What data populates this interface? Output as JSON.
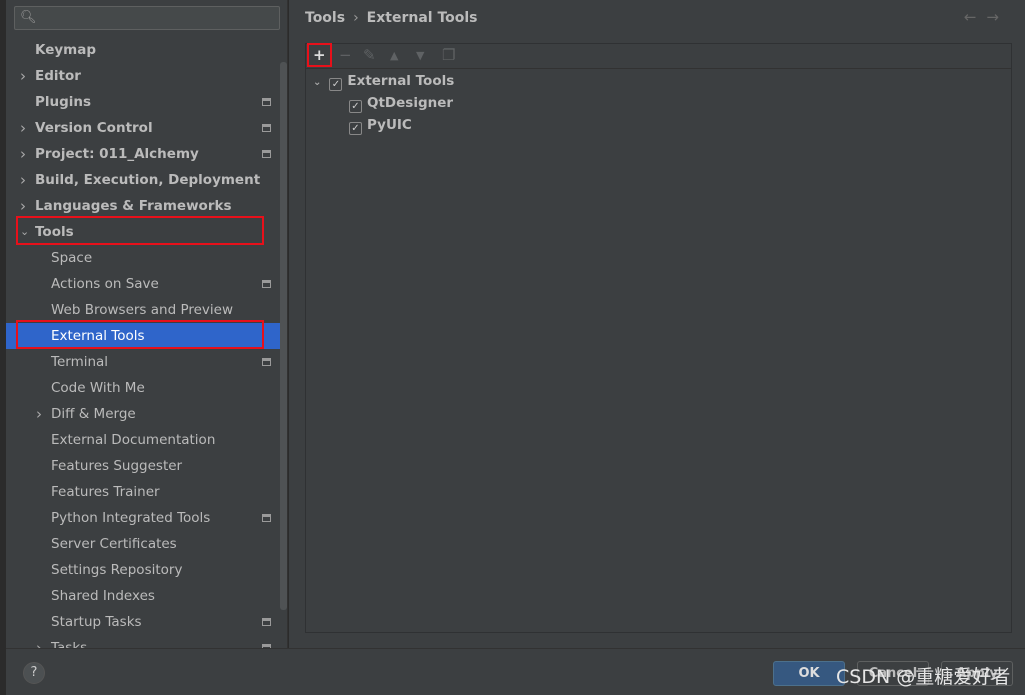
{
  "sidebar": {
    "search_placeholder": "",
    "items": [
      {
        "label": "Keymap",
        "level": 0,
        "arrow": "",
        "proj": false
      },
      {
        "label": "Editor",
        "level": 0,
        "arrow": "right",
        "proj": false
      },
      {
        "label": "Plugins",
        "level": 0,
        "arrow": "",
        "proj": true
      },
      {
        "label": "Version Control",
        "level": 0,
        "arrow": "right",
        "proj": true
      },
      {
        "label": "Project: 011_Alchemy",
        "level": 0,
        "arrow": "right",
        "proj": true
      },
      {
        "label": "Build, Execution, Deployment",
        "level": 0,
        "arrow": "right",
        "proj": false
      },
      {
        "label": "Languages & Frameworks",
        "level": 0,
        "arrow": "right",
        "proj": false
      },
      {
        "label": "Tools",
        "level": 0,
        "arrow": "down",
        "proj": false,
        "highlight": true
      },
      {
        "label": "Space",
        "level": 1,
        "arrow": "",
        "proj": false
      },
      {
        "label": "Actions on Save",
        "level": 1,
        "arrow": "",
        "proj": true
      },
      {
        "label": "Web Browsers and Preview",
        "level": 1,
        "arrow": "",
        "proj": false
      },
      {
        "label": "External Tools",
        "level": 1,
        "arrow": "",
        "proj": false,
        "selected": true,
        "highlight": true
      },
      {
        "label": "Terminal",
        "level": 1,
        "arrow": "",
        "proj": true
      },
      {
        "label": "Code With Me",
        "level": 1,
        "arrow": "",
        "proj": false
      },
      {
        "label": "Diff & Merge",
        "level": 1,
        "arrow": "right",
        "proj": false
      },
      {
        "label": "External Documentation",
        "level": 1,
        "arrow": "",
        "proj": false
      },
      {
        "label": "Features Suggester",
        "level": 1,
        "arrow": "",
        "proj": false
      },
      {
        "label": "Features Trainer",
        "level": 1,
        "arrow": "",
        "proj": false
      },
      {
        "label": "Python Integrated Tools",
        "level": 1,
        "arrow": "",
        "proj": true
      },
      {
        "label": "Server Certificates",
        "level": 1,
        "arrow": "",
        "proj": false
      },
      {
        "label": "Settings Repository",
        "level": 1,
        "arrow": "",
        "proj": false
      },
      {
        "label": "Shared Indexes",
        "level": 1,
        "arrow": "",
        "proj": false
      },
      {
        "label": "Startup Tasks",
        "level": 1,
        "arrow": "",
        "proj": true
      },
      {
        "label": "Tasks",
        "level": 1,
        "arrow": "right",
        "proj": true
      }
    ]
  },
  "main": {
    "breadcrumb": [
      "Tools",
      "External Tools"
    ],
    "toolbar": [
      "add-icon",
      "remove-icon",
      "edit-icon",
      "move-up-icon",
      "move-down-icon",
      "copy-icon"
    ],
    "tree": {
      "group": "External Tools",
      "group_checked": true,
      "items": [
        {
          "label": "QtDesigner",
          "checked": true
        },
        {
          "label": "PyUIC",
          "checked": true
        }
      ]
    }
  },
  "footer": {
    "help": "?",
    "ok": "OK",
    "cancel": "Cancel",
    "apply": "Apply"
  },
  "watermark": "CSDN @重糖爱好者",
  "colors": {
    "selection": "#2f65ca",
    "highlight": "#e8101a",
    "ok": "#365880"
  }
}
